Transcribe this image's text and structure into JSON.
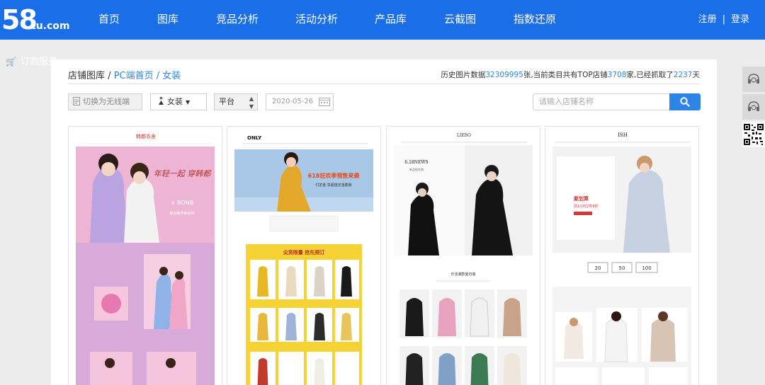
{
  "header": {
    "logo_big": "58",
    "logo_small": "tu.com",
    "nav": [
      "首页",
      "图库",
      "竞品分析",
      "活动分析",
      "产品库",
      "云截图",
      "指数还原"
    ],
    "register": "注册",
    "separator": "|",
    "login": "登录"
  },
  "sidebar_link": "订购服务",
  "breadcrumb": {
    "root": "店铺图库",
    "sep": "/",
    "level2": "PC端首页",
    "level3": "女装"
  },
  "stats": {
    "prefix": "历史图片数据",
    "image_count": "32309995",
    "middle": "张,当前类目共有TOP店铺",
    "shop_count": "3708",
    "middle2": "家,已经抓取了",
    "days": "2237",
    "suffix": "天"
  },
  "filters": {
    "switch_label": "切换为无线端",
    "category": "女装",
    "platform": "平台",
    "date": "2020-05-26",
    "search_placeholder": "请输入店铺名称"
  },
  "tiles": [
    {
      "brand": "韩都衣舍",
      "headline": "年轻一起 穿韩都",
      "collab": "× BONB",
      "subtext": "联合跨界新系列"
    },
    {
      "brand": "ONLY",
      "headline": "618狂欢季预售来袭",
      "subtext": "付定金 享超值定金膨胀",
      "promo": "尖货限量 抢先预订"
    },
    {
      "brand": "LIEBO",
      "headline": "6.18NEWS",
      "subtext": "新品抢先购",
      "section": "乐活潮款夏日装"
    },
    {
      "brand": "ISH",
      "headline": "聚划算",
      "subtext": "前1小时2件8折",
      "coupons": [
        "20",
        "50",
        "100"
      ]
    }
  ],
  "colors": {
    "header_bg": "#1a6ee8",
    "link": "#2e88e0",
    "search_button": "#2d84e6"
  }
}
